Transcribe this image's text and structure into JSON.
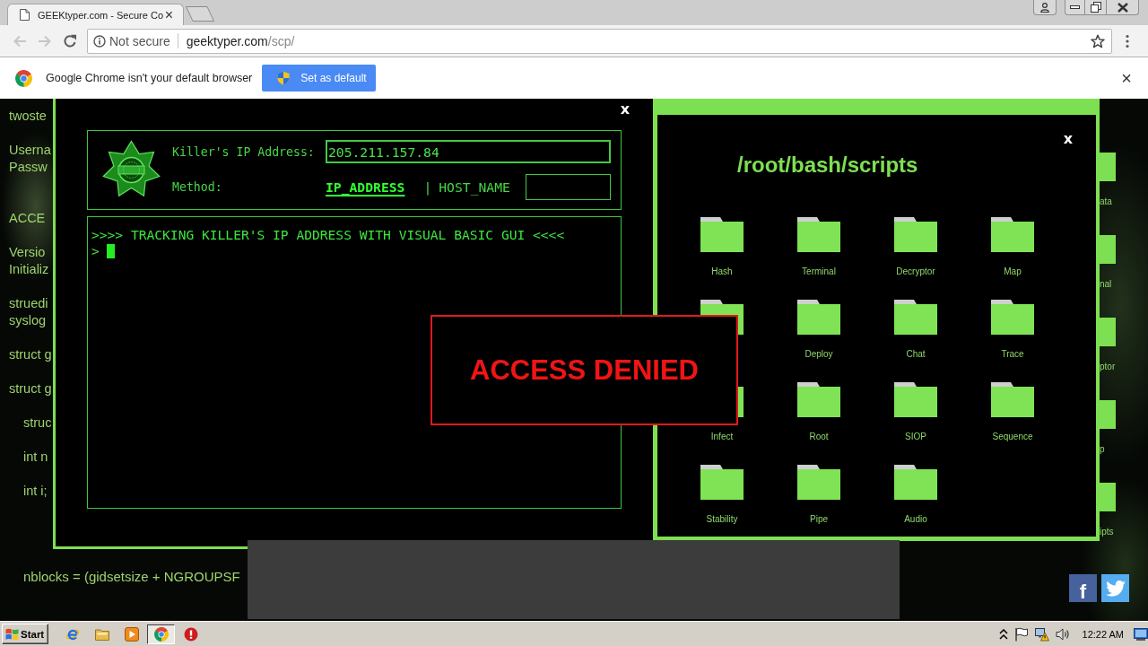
{
  "browser": {
    "tabs": [
      {
        "title": "GEEKtyper.com - Secure Co",
        "close": "×",
        "selected": true
      }
    ],
    "nav": [
      {
        "kind": "back",
        "disabled": true
      },
      {
        "kind": "forward",
        "disabled": true
      },
      {
        "kind": "reload",
        "disabled": false
      }
    ],
    "address": {
      "security": "Not secure",
      "host": "geektyper.com",
      "path": "/scp/"
    },
    "infobar": {
      "message": "Google Chrome isn't your default browser",
      "button": "Set as default",
      "close": "×"
    }
  },
  "page": {
    "code_lines": [
      {
        "lines": [
          "twoste"
        ]
      },
      {
        "lines": [
          "Userna",
          "Passw"
        ]
      },
      {
        "lines": [
          "ACCE"
        ]
      },
      {
        "lines": [
          "Versio",
          "Initializ"
        ]
      },
      {
        "lines": [
          "struedi",
          "syslog"
        ]
      },
      {
        "lines": [
          "struct g"
        ]
      },
      {
        "lines": [
          "struct g"
        ],
        "children": [
          {
            "lines": [
              "struc"
            ]
          },
          {
            "lines": [
              "int n"
            ]
          },
          {
            "lines": [
              "int i;"
            ]
          },
          {
            "lines": [
              "nblocks = (gidsetsize + NGROUPSF"
            ]
          }
        ]
      }
    ],
    "desktop_icons": [
      {
        "label": "ata"
      },
      {
        "label": "nal"
      },
      {
        "label": "ptor"
      },
      {
        "label": "p"
      },
      {
        "label": "ipts"
      }
    ],
    "tracker_window": {
      "close": "x",
      "ip_label": "Killer's IP Address:",
      "ip_value": "205.211.157.84",
      "method_label": "Method:",
      "methods": [
        {
          "label": "IP_ADDRESS",
          "selected": true
        },
        {
          "label": "HOST_NAME",
          "selected": false
        }
      ],
      "separator": "|",
      "terminal": {
        "lines": [
          ">>>> TRACKING KILLER'S IP ADDRESS WITH VISUAL BASIC GUI <<<<"
        ],
        "prompt": ">",
        "cursor": true
      }
    },
    "scripts_window": {
      "close": "x",
      "title": "/root/bash/scripts",
      "folders": [
        {
          "kind": "folder",
          "label": "Hash"
        },
        {
          "kind": "folder",
          "label": "Terminal"
        },
        {
          "kind": "folder",
          "label": "Decryptor"
        },
        {
          "kind": "folder",
          "label": "Map"
        },
        {
          "kind": "folder"
        },
        {
          "kind": "folder",
          "label": "Deploy"
        },
        {
          "kind": "folder",
          "label": "Chat"
        },
        {
          "kind": "folder",
          "label": "Trace"
        },
        {
          "kind": "folder",
          "label": "Infect"
        },
        {
          "kind": "folder",
          "label": "Root"
        },
        {
          "kind": "folder",
          "label": "SIOP"
        },
        {
          "kind": "folder",
          "label": "Sequence"
        },
        {
          "kind": "folder",
          "label": "Stability"
        },
        {
          "kind": "folder",
          "label": "Pipe"
        },
        {
          "kind": "folder",
          "label": "Audio"
        }
      ]
    },
    "alert": {
      "message": "ACCESS DENIED"
    },
    "share_buttons": [
      {
        "kind": "facebook",
        "label": "f"
      },
      {
        "kind": "twitter"
      }
    ]
  },
  "taskbar": {
    "start": "Start",
    "apps": [
      {
        "kind": "ie",
        "selected": false
      },
      {
        "kind": "explorer",
        "selected": false
      },
      {
        "kind": "media",
        "selected": false
      },
      {
        "kind": "chrome",
        "selected": true
      },
      {
        "kind": "stop",
        "selected": false
      }
    ],
    "tray": [
      {
        "kind": "chevron"
      },
      {
        "kind": "flag"
      },
      {
        "kind": "network"
      },
      {
        "kind": "speaker"
      }
    ],
    "clock": "12:22 AM"
  }
}
